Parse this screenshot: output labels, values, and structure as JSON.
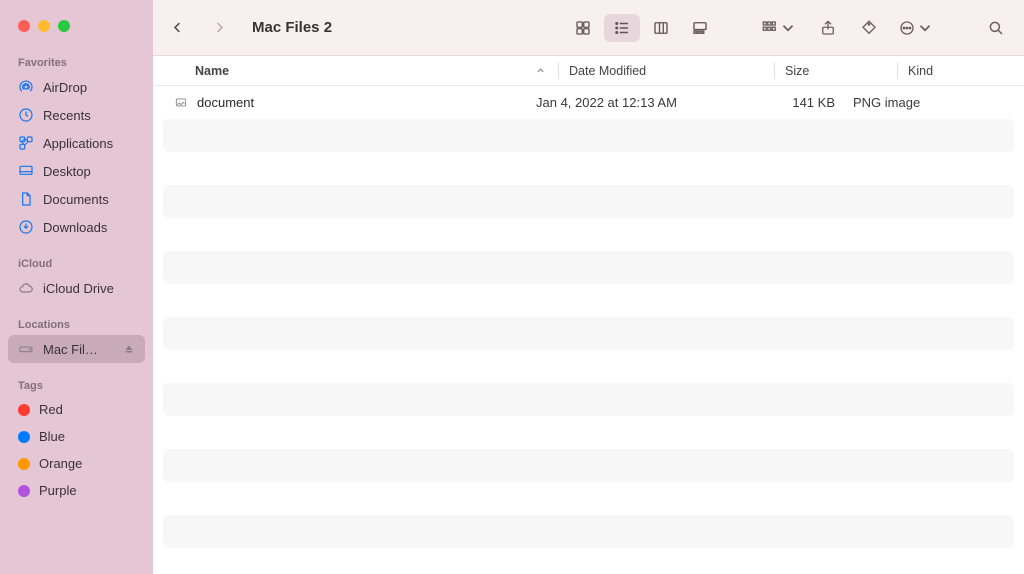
{
  "window": {
    "title": "Mac Files 2"
  },
  "sidebar": {
    "sections": {
      "favorites": {
        "title": "Favorites",
        "items": [
          {
            "label": "AirDrop"
          },
          {
            "label": "Recents"
          },
          {
            "label": "Applications"
          },
          {
            "label": "Desktop"
          },
          {
            "label": "Documents"
          },
          {
            "label": "Downloads"
          }
        ]
      },
      "icloud": {
        "title": "iCloud",
        "items": [
          {
            "label": "iCloud Drive"
          }
        ]
      },
      "locations": {
        "title": "Locations",
        "items": [
          {
            "label": "Mac Fil…"
          }
        ]
      },
      "tags": {
        "title": "Tags",
        "items": [
          {
            "label": "Red",
            "color": "#ff3b30"
          },
          {
            "label": "Blue",
            "color": "#007aff"
          },
          {
            "label": "Orange",
            "color": "#ff9500"
          },
          {
            "label": "Purple",
            "color": "#af52de"
          }
        ]
      }
    }
  },
  "columns": {
    "name": "Name",
    "date": "Date Modified",
    "size": "Size",
    "kind": "Kind"
  },
  "files": [
    {
      "name": "document",
      "date_modified": "Jan 4, 2022 at 12:13 AM",
      "size": "141 KB",
      "kind": "PNG image"
    }
  ]
}
